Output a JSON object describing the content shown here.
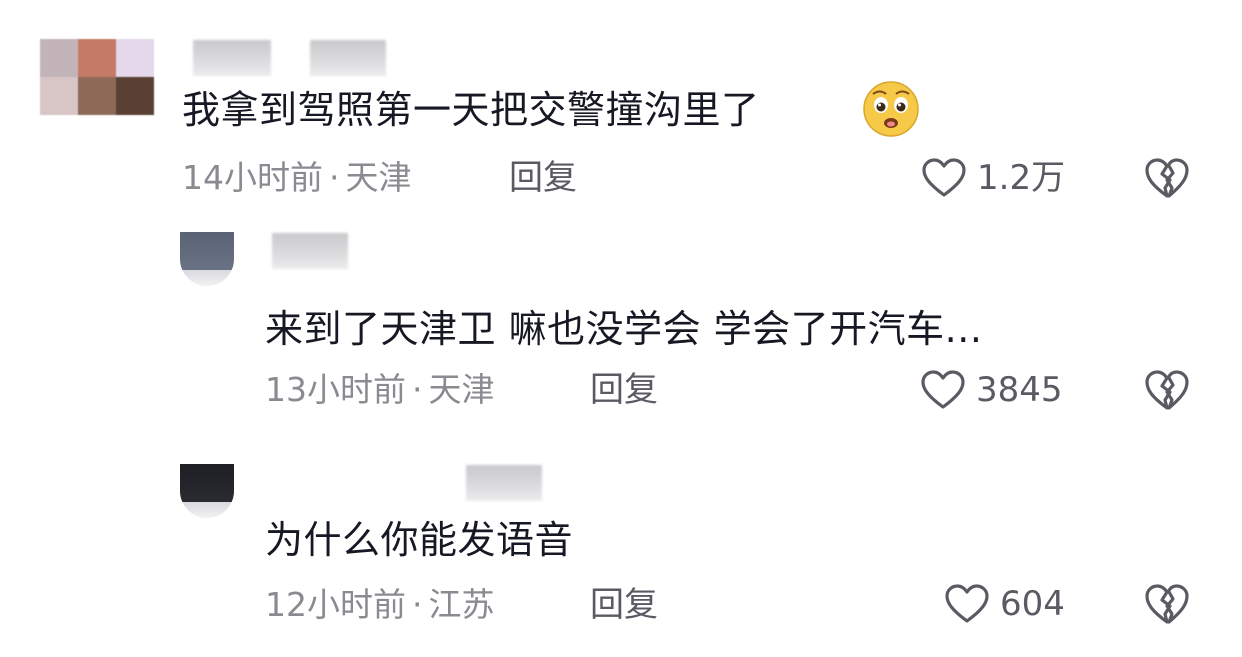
{
  "comments": [
    {
      "text": "我拿到驾照第一天把交警撞沟里了",
      "emoji": "pleading-face-emoji",
      "time": "14小时前",
      "location": "天津",
      "reply_label": "回复",
      "likes": "1.2万"
    },
    {
      "text": "来到了天津卫 嘛也没学会 学会了开汽车...",
      "time": "13小时前",
      "location": "天津",
      "reply_label": "回复",
      "likes": "3845"
    },
    {
      "text": "为什么你能发语音",
      "time": "12小时前",
      "location": "江苏",
      "reply_label": "回复",
      "likes": "604"
    }
  ],
  "separator": "·",
  "colors": {
    "text": "#161823",
    "meta": "#8a8b91",
    "action": "#5a5b62",
    "background": "#ffffff"
  },
  "icons": {
    "like": "heart-outline-icon",
    "dislike": "broken-heart-icon"
  }
}
